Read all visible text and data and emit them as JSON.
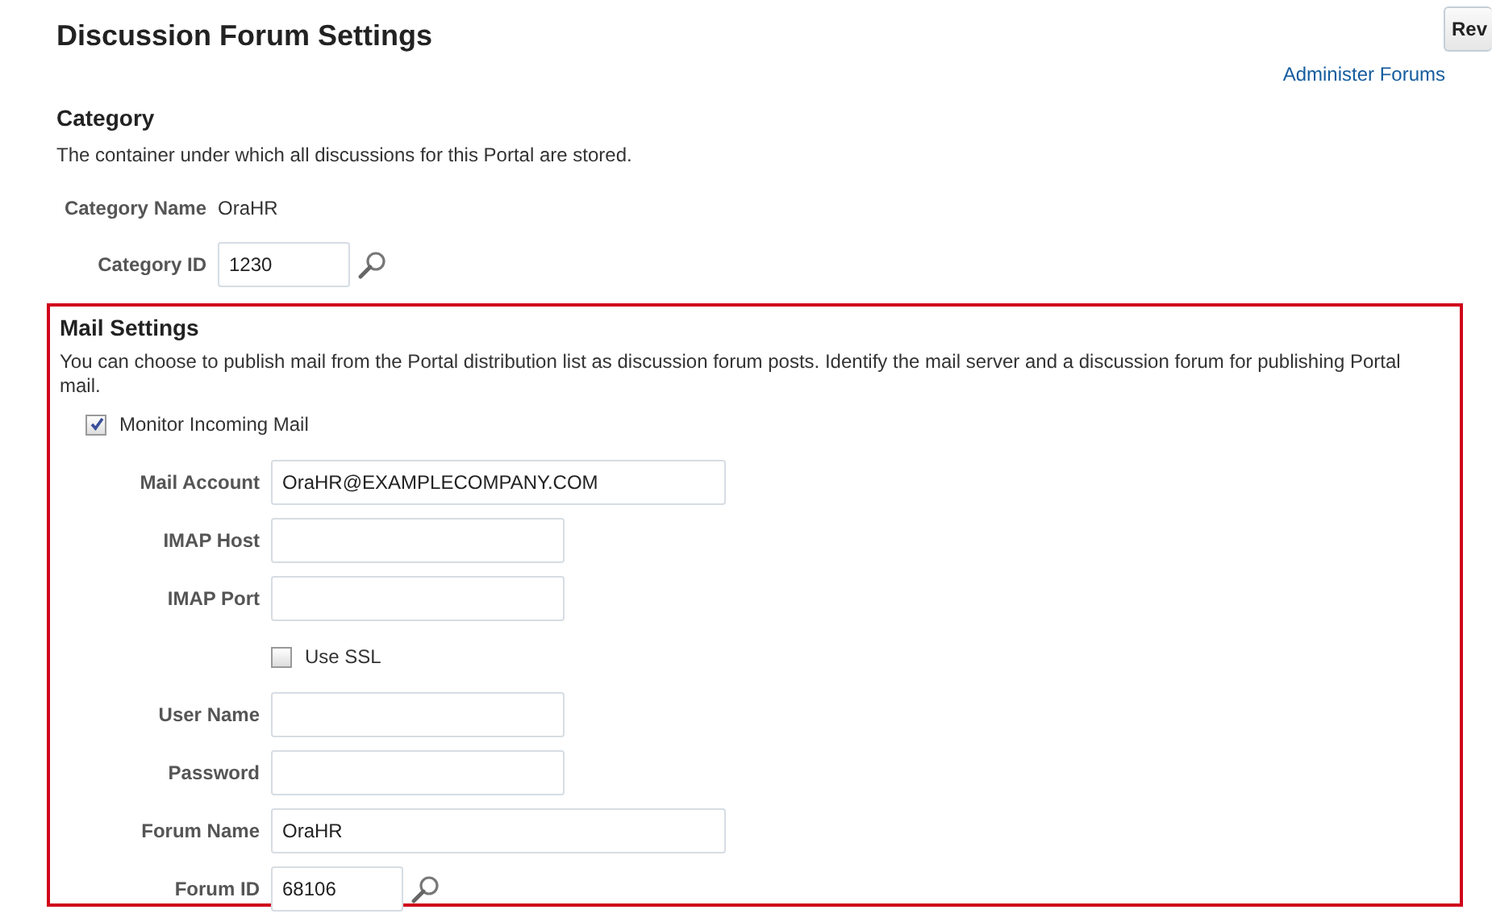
{
  "page": {
    "title": "Discussion Forum Settings",
    "action_button": "Rev",
    "link": "Administer Forums"
  },
  "category": {
    "heading": "Category",
    "description": "The container under which all discussions for this Portal are stored.",
    "fields": [
      {
        "kind": "value",
        "label": "Category Name",
        "value": "OraHR"
      },
      {
        "kind": "lookup",
        "label": "Category ID",
        "value": "1230"
      }
    ]
  },
  "mail_settings": {
    "heading": "Mail Settings",
    "highlighted": true,
    "description": "You can choose to publish mail from the Portal distribution list as discussion forum posts. Identify the mail server and a discussion forum for publishing Portal mail.",
    "fields": [
      {
        "kind": "lead-checkbox",
        "label": "Monitor Incoming Mail",
        "checked": true
      },
      {
        "kind": "wide-text",
        "label": "Mail Account",
        "value": "OraHR@EXAMPLECOMPANY.COM"
      },
      {
        "kind": "text",
        "label": "IMAP Host"
      },
      {
        "kind": "text",
        "label": "IMAP Port"
      },
      {
        "kind": "checkbox",
        "label": "Use SSL",
        "checked": false
      },
      {
        "kind": "text",
        "label": "User Name"
      },
      {
        "kind": "text",
        "label": "Password"
      },
      {
        "kind": "wide-text",
        "label": "Forum Name",
        "value": "OraHR"
      },
      {
        "kind": "lookup",
        "label": "Forum ID",
        "value": "68106"
      }
    ]
  }
}
